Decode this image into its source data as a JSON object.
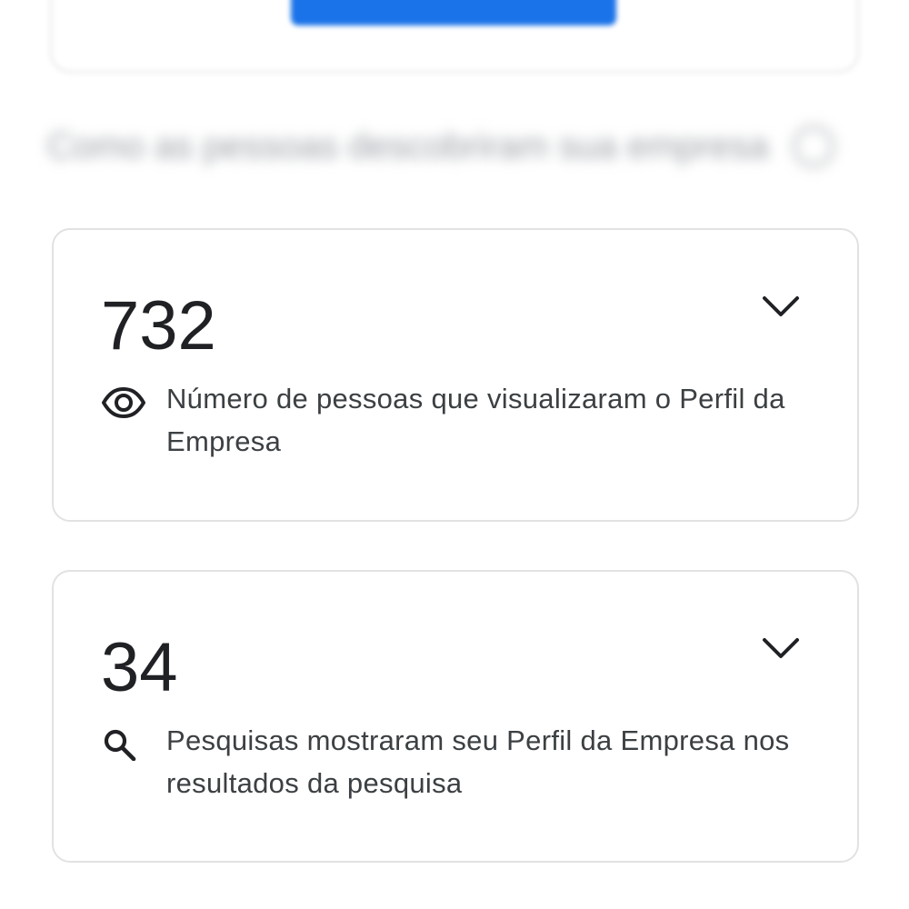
{
  "header": {
    "section_title": "Como as pessoas descobriram sua empresa",
    "help_icon": "help-circle-icon"
  },
  "colors": {
    "accent": "#1a73e8",
    "border": "#e2e2e2",
    "text": "#202124"
  },
  "metrics": [
    {
      "value": "732",
      "icon": "eye-icon",
      "description": "Número de pessoas que visualizaram o Perfil da Empresa",
      "expand_icon": "chevron-down-icon"
    },
    {
      "value": "34",
      "icon": "search-icon",
      "description": "Pesquisas mostraram seu Perfil da Empresa nos resultados da pesquisa",
      "expand_icon": "chevron-down-icon"
    }
  ]
}
